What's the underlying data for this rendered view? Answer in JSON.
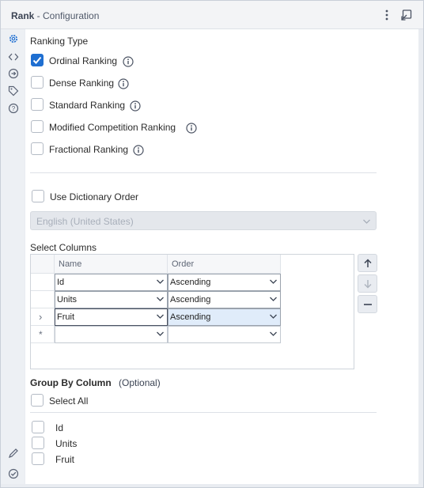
{
  "window": {
    "title_bold": "Rank",
    "title_rest": " - Configuration"
  },
  "ranking_type": {
    "heading": "Ranking Type",
    "options": [
      {
        "label": "Ordinal Ranking",
        "checked": true
      },
      {
        "label": "Dense Ranking",
        "checked": false
      },
      {
        "label": "Standard Ranking",
        "checked": false
      },
      {
        "label": "Modified Competition Ranking",
        "checked": false
      },
      {
        "label": "Fractional Ranking",
        "checked": false
      }
    ]
  },
  "dictionary": {
    "label": "Use Dictionary Order",
    "checked": false,
    "locale_value": "English (United States)"
  },
  "select_columns": {
    "heading": "Select Columns",
    "headers": {
      "name": "Name",
      "order": "Order"
    },
    "rows": [
      {
        "indicator": "",
        "name": "Id",
        "order": "Ascending"
      },
      {
        "indicator": "",
        "name": "Units",
        "order": "Ascending"
      },
      {
        "indicator": "›",
        "name": "Fruit",
        "order": "Ascending"
      },
      {
        "indicator": "*",
        "name": "",
        "order": ""
      }
    ]
  },
  "group_by": {
    "heading": "Group By Column",
    "optional": "(Optional)",
    "select_all": "Select All",
    "columns": [
      "Id",
      "Units",
      "Fruit"
    ]
  },
  "colors": {
    "accent": "#1f6fd1",
    "selected_row": "#e0ecfa"
  }
}
